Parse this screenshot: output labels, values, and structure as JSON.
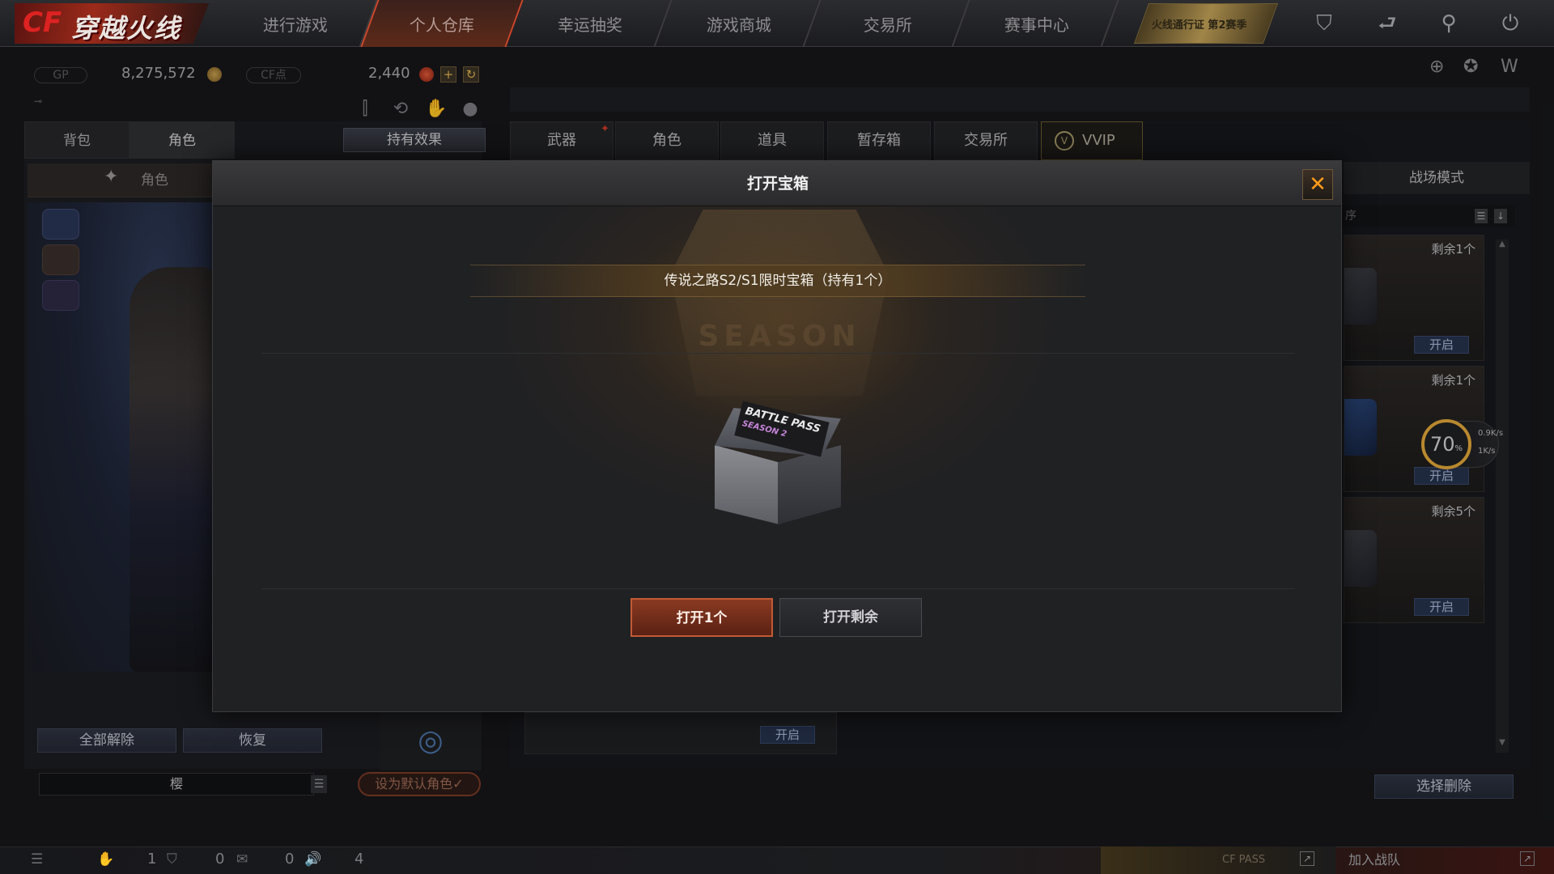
{
  "nav": {
    "logo": "CF穿越火线",
    "tabs": [
      "进行游戏",
      "个人仓库",
      "幸运抽奖",
      "游戏商城",
      "交易所",
      "赛事中心"
    ],
    "active_tab": "个人仓库",
    "pass_banner": "火线通行证 第2赛季",
    "icons": [
      "shield-icon",
      "return-icon",
      "tool-icon",
      "power-icon"
    ]
  },
  "currency": {
    "gp_label": "GP",
    "gp_value": "8,275,572",
    "cf_label": "CF点",
    "cf_value": "2,440",
    "add_symbol": "+",
    "refresh_symbol": "↻"
  },
  "left": {
    "tabs": [
      "背包",
      "角色"
    ],
    "active_tab": "角色",
    "effects_button": "持有效果",
    "role_sub_label": "角色",
    "unequip_all": "全部解除",
    "restore": "恢复",
    "name_value": "樱",
    "default_button": "设为默认角色✓"
  },
  "right": {
    "tabs": [
      "武器",
      "角色",
      "道具",
      "暂存箱",
      "交易所"
    ],
    "vvip_tab": "VVIP",
    "battlefield_tab": "战场模式",
    "sort_label": "序",
    "items": [
      {
        "remain": "剩余1个",
        "open": "开启"
      },
      {
        "remain": "剩余1个",
        "open": "开启"
      },
      {
        "remain": "剩余5个",
        "open": "开启"
      }
    ],
    "lower_open": "开启",
    "select_delete": "选择删除"
  },
  "speed": {
    "percent": "70",
    "percent_unit": "%",
    "upload": "0.9K/s",
    "download": "1K/s"
  },
  "status": {
    "counts": [
      "1",
      "0",
      "0",
      "4"
    ],
    "cf_pass": "CF PASS",
    "join_team": "加入战队"
  },
  "modal": {
    "title": "打开宝箱",
    "close_symbol": "✕",
    "season_word": "SEASON",
    "item_name": "传说之路S2/S1限时宝箱（持有1个）",
    "box_label_main": "BATTLE PASS",
    "box_label_sub": "SEASON 2",
    "open_one": "打开1个",
    "open_rest": "打开剩余"
  }
}
